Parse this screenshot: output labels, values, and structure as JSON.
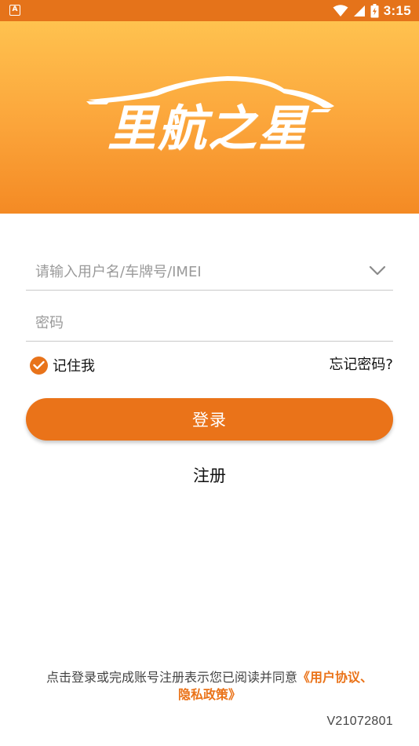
{
  "status_bar": {
    "notification_badge": "A",
    "time": "3:15",
    "icons": [
      "wifi-icon",
      "signal-icon",
      "battery-icon"
    ]
  },
  "hero": {
    "logo_text": "里航之星",
    "gradient_top": "#ffc24f",
    "gradient_bottom": "#f48a24"
  },
  "form": {
    "username_placeholder": "请输入用户名/车牌号/IMEI",
    "username_value": "",
    "password_placeholder": "密码",
    "password_value": "",
    "remember_label": "记住我",
    "remember_checked": true,
    "forgot_label": "忘记密码?",
    "login_label": "登录",
    "register_label": "注册"
  },
  "footer": {
    "agreement_text": "点击登录或完成账号注册表示您已阅读并同意",
    "agreement_link_1": "《用户协议、",
    "agreement_link_2": "隐私政策》",
    "version": "V21072801"
  },
  "colors": {
    "accent": "#ea7319",
    "status_bar": "#e5731a"
  }
}
